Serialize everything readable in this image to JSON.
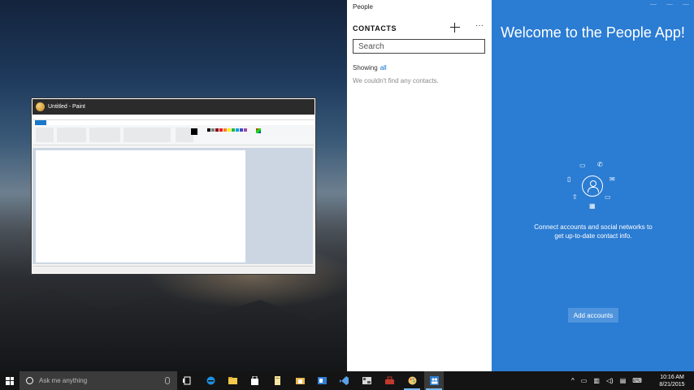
{
  "people_app": {
    "title": "People",
    "contacts_header": "CONTACTS",
    "add_icon": "plus-icon",
    "more_icon": "ellipsis-icon",
    "more_label": "···",
    "search_placeholder": "Search",
    "showing_label": "Showing",
    "showing_filter": "all",
    "empty_message": "We couldn't find any contacts."
  },
  "welcome_pane": {
    "title": "Welcome to the People App!",
    "description": "Connect accounts and social networks to get up-to-date contact info.",
    "add_accounts_label": "Add accounts",
    "colors": {
      "background": "#2b7cd3",
      "button": "#4f94dd"
    }
  },
  "paint_window": {
    "title": "Untitled - Paint"
  },
  "taskbar": {
    "search_placeholder": "Ask me anything",
    "time": "10:16 AM",
    "date": "8/21/2015",
    "apps": [
      "task-view-icon",
      "edge-icon",
      "file-explorer-icon",
      "store-icon",
      "documents-icon",
      "folder-icon",
      "outlook-icon",
      "visual-studio-icon",
      "app-icon",
      "toolbox-icon",
      "paint-icon",
      "people-icon"
    ]
  },
  "accent_color": "#2b7cd3"
}
